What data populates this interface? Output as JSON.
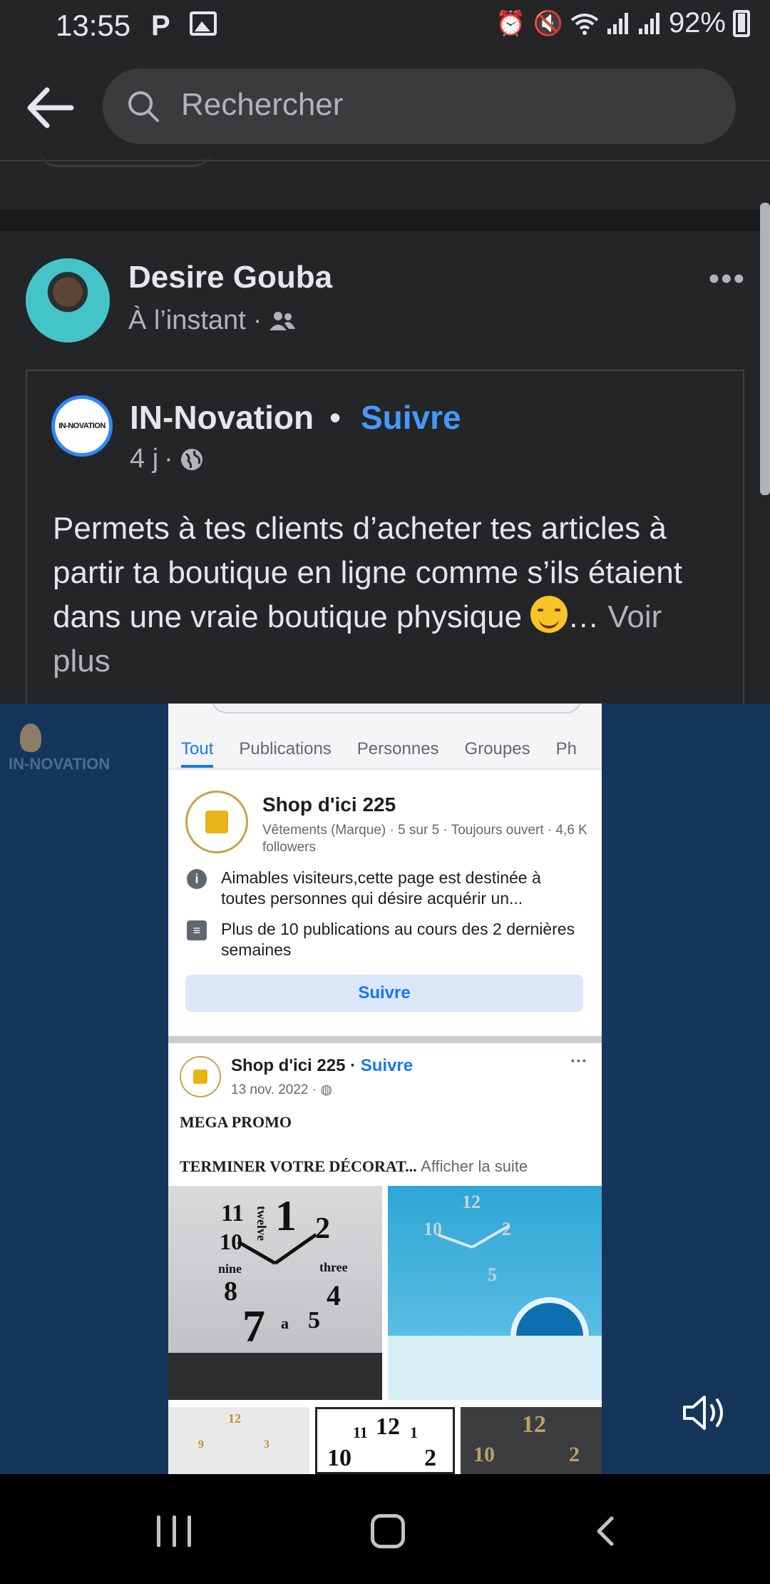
{
  "status_bar": {
    "time": "13:55",
    "app_indicator": "P",
    "battery": "92%",
    "icons": [
      "alarm-icon",
      "mute-icon",
      "wifi-icon",
      "signal-icon",
      "signal-icon",
      "battery-icon"
    ]
  },
  "search": {
    "placeholder": "Rechercher"
  },
  "post": {
    "author": "Desire Gouba",
    "time": "À l’instant",
    "separator": "·",
    "audience_icon": "friends-icon",
    "shared": {
      "page_name": "IN-Novation",
      "page_logo_text": "IN-NOVATION",
      "follow": "Suivre",
      "time": "4 j",
      "text": "Permets à tes clients d’acheter tes articles à partir ta boutique en ligne comme s’ils étaient dans une vraie boutique physique ",
      "ellipsis": "…",
      "see_more": "Voir plus"
    }
  },
  "video": {
    "watermark": "IN-NOVATION",
    "phone": {
      "tabs": [
        "Tout",
        "Publications",
        "Personnes",
        "Groupes",
        "Ph"
      ],
      "page": {
        "title": "Shop d'ici 225",
        "subtitle": "Vêtements (Marque) · 5 sur 5 · Toujours ouvert · 4,6 K followers",
        "about": "Aimables visiteurs,cette page est destinée à toutes personnes qui désire acquérir un...",
        "activity": "Plus de 10 publications au cours des 2 dernières semaines",
        "follow": "Suivre"
      },
      "post": {
        "name": "Shop d'ici 225",
        "follow": "Suivre",
        "date": "13 nov. 2022 ·",
        "promo": "MEGA PROMO",
        "headline": "TERMINER VOTRE DÉCORAT...",
        "see_more": "Afficher la suite"
      },
      "clock_numbers": {
        "n11": "11",
        "n1": "1",
        "n2": "2",
        "n10": "10",
        "n8": "8",
        "n4": "4",
        "n7": "7",
        "n5": "5",
        "n3": "3",
        "n9": "9",
        "n12": "12",
        "twelve": "twelve",
        "nine": "nine",
        "three": "three",
        "six": "a"
      }
    }
  },
  "nav": {
    "recent": "recents-icon",
    "home": "home-icon",
    "back": "back-icon"
  }
}
